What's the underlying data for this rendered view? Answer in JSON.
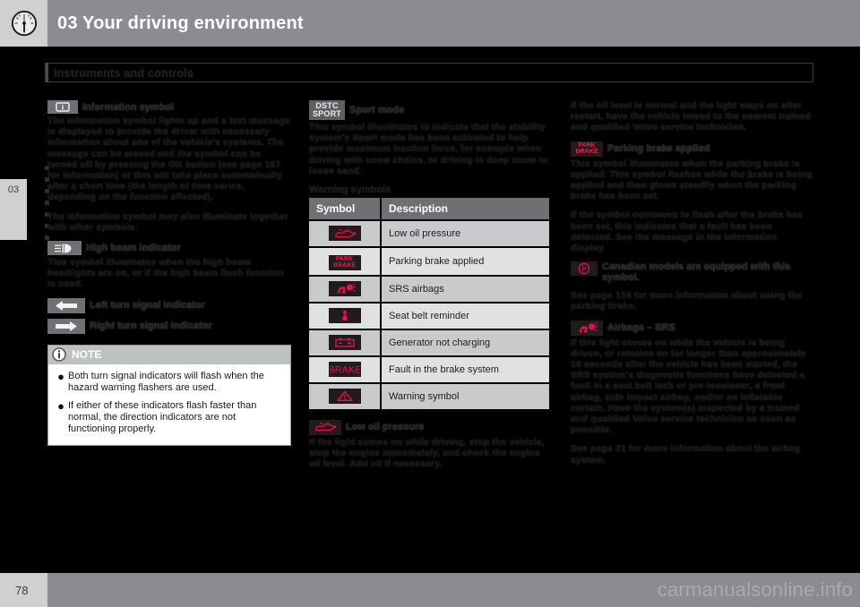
{
  "header": {
    "chapter_number": "03",
    "title": "03 Your driving environment",
    "gauge_icon": "speedometer-icon"
  },
  "section": {
    "heading": "Instruments and controls"
  },
  "chapter_tab": {
    "label": "03"
  },
  "column_left": {
    "information_symbol": {
      "icon": "information-symbol-icon",
      "icon_label": "i",
      "heading": "Information symbol",
      "paragraph_1": "The information symbol lights up and a text message is displayed to provide the driver with necessary information about one of the vehicle's systems. The message can be erased and the symbol can be turned off by pressing the OK button (see page 167 for information) or this will take place automatically after a short time (the length of time varies, depending on the function affected).",
      "paragraph_2": "The information symbol may also illuminate together with other symbols."
    },
    "high_beam": {
      "icon": "high-beam-indicator-icon",
      "heading": "High beam indicator",
      "paragraph": "This symbol illuminates when the high beam headlights are on, or if the high beam flash function is used."
    },
    "left_turn": {
      "icon": "left-arrow-icon",
      "heading": "Left turn signal indicator"
    },
    "right_turn": {
      "icon": "right-arrow-icon",
      "heading": "Right turn signal indicator"
    },
    "note": {
      "icon": "info-circle-icon",
      "title": "NOTE",
      "bullet_char": "●",
      "items": [
        "Both turn signal indicators will flash when the hazard warning flashers are used.",
        "If either of these indicators flash faster than normal, the direction indicators are not functioning properly."
      ]
    }
  },
  "column_middle": {
    "sport_mode": {
      "icon": "dstc-sport-icon",
      "icon_line_1": "DSTC",
      "icon_line_2": "SPORT",
      "heading": "Sport mode",
      "paragraph": "This symbol illuminates to indicate that the stability system's Sport mode has been activated to help provide maximum traction force, for example when driving with snow chains, or driving in deep snow or loose sand."
    },
    "warning_symbols_heading": "Warning symbols",
    "table": {
      "columns": [
        "Symbol",
        "Description"
      ],
      "rows": [
        {
          "icon": "oil-can-icon",
          "description": "Low oil pressure"
        },
        {
          "icon": "park-brake-icon",
          "description": "Parking brake applied"
        },
        {
          "icon": "srs-airbag-icon",
          "description": "SRS airbags"
        },
        {
          "icon": "seat-belt-icon",
          "description": "Seat belt reminder"
        },
        {
          "icon": "battery-icon",
          "description": "Generator not charging"
        },
        {
          "icon": "brake-text-icon",
          "description": "Fault in the brake system"
        },
        {
          "icon": "warning-triangle-icon",
          "description": "Warning symbol"
        }
      ]
    },
    "low_oil_pressure": {
      "icon": "oil-can-icon",
      "heading": "Low oil pressure",
      "paragraph": "If the light comes on while driving, stop the vehicle, stop the engine immediately, and check the engine oil level. Add oil if necessary."
    }
  },
  "column_right": {
    "oil_continued": "If the oil level is normal and the light stays on after restart, have the vehicle towed to the nearest trained and qualified Volvo service technician.",
    "parking_brake": {
      "icon": "park-brake-icon",
      "icon_line_1": "PARK",
      "icon_line_2": "BRAKE",
      "heading": "Parking brake applied",
      "paragraph_1": "This symbol illuminates when the parking brake is applied. This symbol flashes while the brake is being applied and then glows steadily when the parking brake has been set.",
      "paragraph_2": "If the symbol continues to flash after the brake has been set, this indicates that a fault has been detected. See the message in the information display.",
      "canadian_icon": "p-circle-icon",
      "canadian_icon_label": "P",
      "canadian_note": "Canadian models are equipped with this symbol.",
      "reference": "See page 124 for more information about using the parking brake."
    },
    "airbags": {
      "icon": "srs-airbag-icon",
      "heading": "Airbags – SRS",
      "paragraph": "If this light comes on while the vehicle is being driven, or remains on for longer than approximately 10 seconds after the vehicle has been started, the SRS system's diagnostic functions have detected a fault in a seat belt lock or pre-tensioner, a front airbag, side impact airbag, and/or an inflatable curtain. Have the system(s) inspected by a trained and qualified Volvo service technician as soon as possible.",
      "reference": "See page 21 for more information about the airbag system."
    }
  },
  "footer": {
    "page_number": "78",
    "watermark": "carmanualsonline.info"
  }
}
